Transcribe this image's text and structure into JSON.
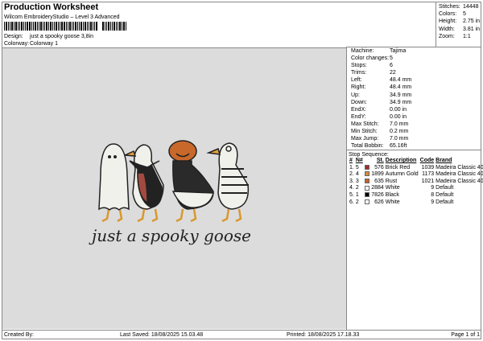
{
  "header": {
    "title": "Production Worksheet",
    "subtitle": "Wilcom EmbroideryStudio – Level 3 Advanced",
    "design_label": "Design:",
    "design_value": "just a spooky goose 3,8in",
    "colorway_label": "Colorway:",
    "colorway_value": "Colorway 1"
  },
  "stats": [
    {
      "k": "Stitches:",
      "v": "14448"
    },
    {
      "k": "Colors:",
      "v": "5"
    },
    {
      "k": "Height:",
      "v": "2.75 in"
    },
    {
      "k": "Width:",
      "v": "3.81 in"
    },
    {
      "k": "Zoom:",
      "v": "1:1"
    }
  ],
  "design": {
    "text": "just a spooky goose"
  },
  "info": [
    {
      "k": "Machine:",
      "v": "Tajima"
    },
    {
      "k": "Color changes:",
      "v": "5"
    },
    {
      "k": "Stops:",
      "v": "6"
    },
    {
      "k": "Trims:",
      "v": "22"
    },
    {
      "k": "Left:",
      "v": "48.4 mm"
    },
    {
      "k": "Right:",
      "v": "48.4 mm"
    },
    {
      "k": "Up:",
      "v": "34.9 mm"
    },
    {
      "k": "Down:",
      "v": "34.9 mm"
    },
    {
      "k": "EndX:",
      "v": "0.00 in"
    },
    {
      "k": "EndY:",
      "v": "0.00 in"
    },
    {
      "k": "Max Stitch:",
      "v": "7.0 mm"
    },
    {
      "k": "Min Stitch:",
      "v": "0.2 mm"
    },
    {
      "k": "Max Jump:",
      "v": "7.0 mm"
    },
    {
      "k": "Total Bobbin:",
      "v": "65.16ft"
    }
  ],
  "stop_sequence": {
    "title": "Stop Sequence:",
    "headers": [
      "#",
      "N#",
      "St.",
      "Description",
      "Code",
      "Brand"
    ],
    "rows": [
      {
        "n": "1.",
        "c": "5",
        "color": "#a32a2a",
        "st": "576",
        "desc": "Brick Red",
        "code": "1039",
        "brand": "Madeira Classic 40"
      },
      {
        "n": "2.",
        "c": "4",
        "color": "#d98b3a",
        "st": "1899",
        "desc": "Autumn Gold",
        "code": "1173",
        "brand": "Madeira Classic 40"
      },
      {
        "n": "3.",
        "c": "3",
        "color": "#c8602a",
        "st": "635",
        "desc": "Rust",
        "code": "1021",
        "brand": "Madeira Classic 40"
      },
      {
        "n": "4.",
        "c": "2",
        "color": "#ffffff",
        "st": "2884",
        "desc": "White",
        "code": "9",
        "brand": "Default"
      },
      {
        "n": "5.",
        "c": "1",
        "color": "#000000",
        "st": "7826",
        "desc": "Black",
        "code": "8",
        "brand": "Default"
      },
      {
        "n": "6.",
        "c": "2",
        "color": "#ffffff",
        "st": "626",
        "desc": "White",
        "code": "9",
        "brand": "Default"
      }
    ]
  },
  "footer": {
    "created": "Created By:",
    "saved": "Last Saved: 18/08/2025 15.03.48",
    "printed": "Printed: 18/08/2025 17.18.33",
    "page": "Page 1 of 1"
  }
}
